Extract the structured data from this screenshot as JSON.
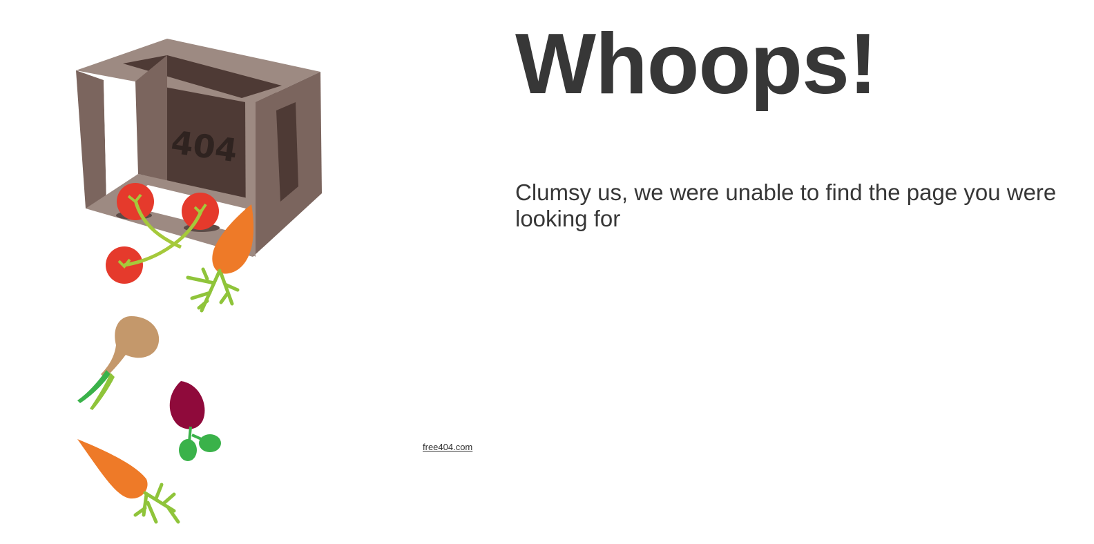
{
  "headline": "Whoops!",
  "message": "Clumsy us, we were unable to find the page you were looking for",
  "credit_link": "free404.com",
  "crate_label": "404",
  "colors": {
    "text": "#373737",
    "crate_light": "#9d8a82",
    "crate_mid": "#7b655e",
    "crate_dark": "#4e3a35",
    "tomato": "#e53a2c",
    "carrot": "#ee7a28",
    "leaf": "#8fc43a",
    "potato": "#c4986b",
    "beet": "#8f0a3b",
    "beet_leaf": "#3ab24a"
  },
  "icons": [
    "crate-icon",
    "tomato-icon",
    "carrot-icon",
    "potato-icon",
    "beet-icon"
  ]
}
